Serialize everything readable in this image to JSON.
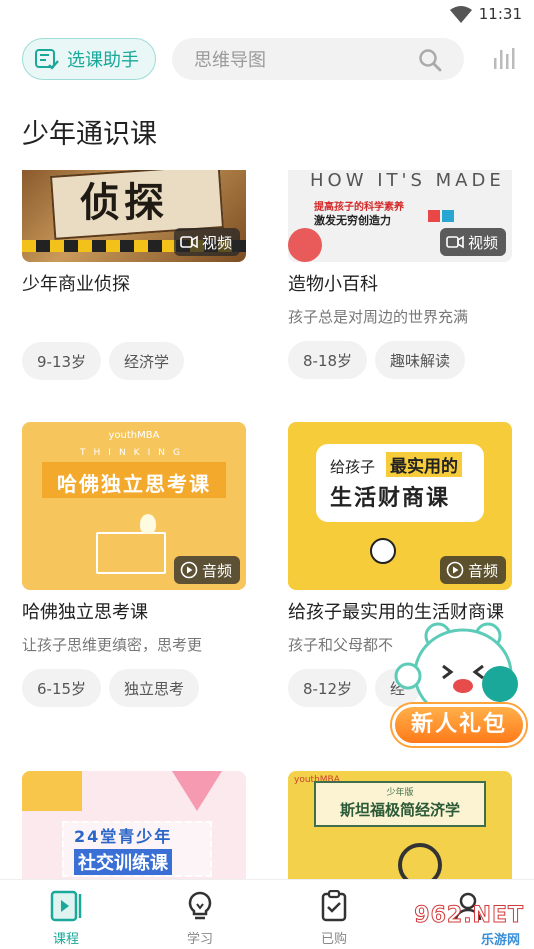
{
  "status": {
    "time": "11:31"
  },
  "header": {
    "assistant_label": "选课助手",
    "search_placeholder": "思维导图"
  },
  "section": {
    "title": "少年通识课"
  },
  "courses": [
    {
      "title": "少年商业侦探",
      "description": "",
      "media": "视频",
      "tags": [
        "9-13岁",
        "经济学"
      ],
      "cover_text": "侦探"
    },
    {
      "title": "造物小百科",
      "description": "孩子总是对周边的世界充满",
      "media": "视频",
      "tags": [
        "8-18岁",
        "趣味解读"
      ],
      "cover_text": "HOW IT'S MADE",
      "cover_sub1": "提高孩子的科学素养",
      "cover_sub2": "激发无穷创造力"
    },
    {
      "title": "哈佛独立思考课",
      "description": "让孩子思维更缜密，思考更",
      "media": "音频",
      "tags": [
        "6-15岁",
        "独立思考"
      ],
      "cover_text": "哈佛独立思考课",
      "cover_brand": "youthMBA",
      "cover_ribbon": "THINKING"
    },
    {
      "title": "给孩子最实用的生活财商课",
      "description": "孩子和父母都不",
      "media": "音频",
      "tags": [
        "8-12岁",
        "经"
      ],
      "cover_text1": "给孩子",
      "cover_text2": "最实用的",
      "cover_text3": "生活财商课"
    },
    {
      "title": "",
      "cover_text1": "24堂青少年",
      "cover_text2": "社交训练课"
    },
    {
      "title": "",
      "cover_brand": "youthMBA",
      "cover_small": "少年版",
      "cover_text": "斯坦福极简经济学"
    }
  ],
  "gift": {
    "label": "新人礼包"
  },
  "nav": [
    {
      "label": "课程",
      "icon": "course-icon"
    },
    {
      "label": "学习",
      "icon": "bulb-icon"
    },
    {
      "label": "已购",
      "icon": "clipboard-icon"
    },
    {
      "label": "",
      "icon": "profile-icon"
    }
  ],
  "watermark": {
    "text": "962.NET",
    "sub": "乐游网"
  },
  "colors": {
    "accent": "#1aa89a",
    "gift": "#ff8a24"
  }
}
